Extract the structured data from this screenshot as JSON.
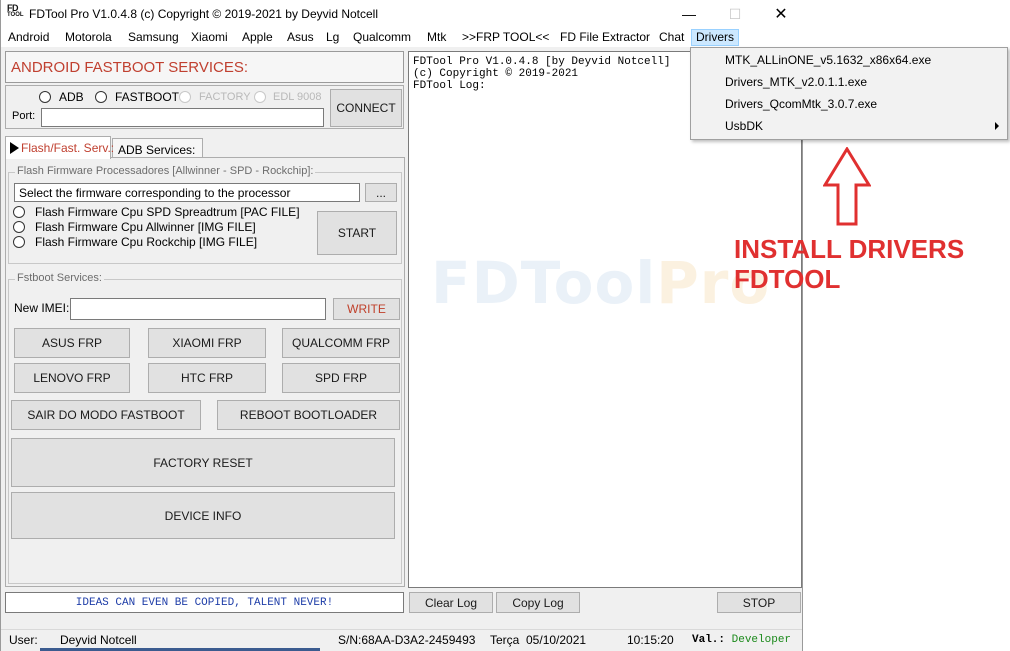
{
  "window": {
    "title": "FDTool Pro V1.0.4.8 (c) Copyright © 2019-2021 by Deyvid Notcell",
    "logo_top": "FD",
    "logo_bottom": "TOOL",
    "min_glyph": "—",
    "max_glyph": "☐",
    "close_glyph": "✕"
  },
  "menu": [
    "Android",
    "Motorola",
    "Samsung",
    "Xiaomi",
    "Apple",
    "Asus",
    "Lg",
    "Qualcomm",
    "Mtk",
    ">>FRP TOOL<<",
    "FD File Extractor",
    "Chat",
    "Drivers"
  ],
  "panel_title": "ANDROID FASTBOOT SERVICES:",
  "connection": {
    "modes": [
      "ADB",
      "FASTBOOT",
      "FACTORY",
      "EDL 9008"
    ],
    "port_label": "Port:",
    "port_value": "",
    "connect_label": "CONNECT"
  },
  "tabs": [
    "Flash/Fast. Serv.:",
    "ADB Services:"
  ],
  "flash": {
    "group_title": "Flash Firmware Processadores [Allwinner - SPD - Rockchip]:",
    "select_text": "Select the firmware corresponding to the processor",
    "browse_label": "...",
    "options": [
      "Flash Firmware  Cpu SPD Spreadtrum [PAC FILE]",
      "Flash Firmware Cpu Allwinner [IMG FILE]",
      "Flash Firmware Cpu Rockchip [IMG FILE]"
    ],
    "start_label": "START"
  },
  "fastboot": {
    "group_title": "Fstboot Services:",
    "imei_label": "New IMEI:",
    "imei_value": "",
    "write_label": "WRITE",
    "frp_buttons": [
      "ASUS FRP",
      "XIAOMI FRP",
      "QUALCOMM FRP",
      "LENOVO FRP",
      "HTC FRP",
      "SPD FRP"
    ],
    "exit_fastboot": "SAIR DO MODO FASTBOOT",
    "reboot_bootloader": "REBOOT BOOTLOADER",
    "factory_reset": "FACTORY RESET",
    "device_info": "DEVICE INFO"
  },
  "log": {
    "lines": [
      "FDTool Pro V1.0.4.8 [by Deyvid Notcell]",
      "(c) Copyright © 2019-2021",
      "",
      "FDTool Log:"
    ],
    "watermark_a": "FDTool",
    "watermark_b": "Pro"
  },
  "motto": "IDEAS CAN EVEN BE COPIED, TALENT NEVER!",
  "log_buttons": {
    "clear": "Clear Log",
    "copy": "Copy Log",
    "stop": "STOP"
  },
  "status": {
    "user_label": "User:",
    "user_value": "Deyvid Notcell",
    "serial": "S/N:68AA-D3A2-2459493",
    "date": "Terça  05/10/2021",
    "time": "10:15:20",
    "val_label": "Val.:",
    "val_value": "Developer"
  },
  "drivers_menu": [
    "MTK_ALLinONE_v5.1632_x86x64.exe",
    "Drivers_MTK_v2.0.1.1.exe",
    "Drivers_QcomMtk_3.0.7.exe",
    "UsbDK"
  ],
  "annotation": {
    "line1": "INSTALL DRIVERS",
    "line2": "FDTOOL",
    "color": "#e03030"
  },
  "colors": {
    "accent_red": "#c04030",
    "menu_highlight": "#cce8ff",
    "motto_blue": "#1f3ea8",
    "developer_green": "#1c8a1c"
  }
}
